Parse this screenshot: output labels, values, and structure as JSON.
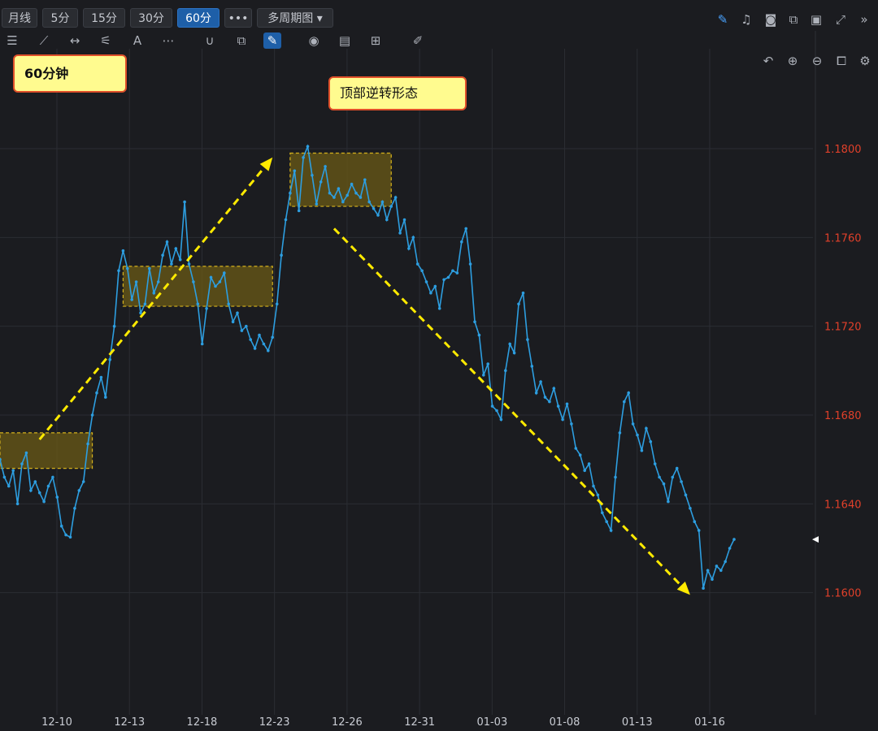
{
  "toolbar": {
    "periods": [
      "月线",
      "5分",
      "15分",
      "30分",
      "60分"
    ],
    "active_period": "60分",
    "more_label": "•••",
    "multi_period_label": "多周期图",
    "multi_period_caret": "▾",
    "drawing_tools": [
      "drawing-mode-icon",
      "ray-icon",
      "fib-fan-icon",
      "range-icon",
      "pitchfork-icon",
      "text-icon",
      "more-tools-icon",
      "magnet-icon",
      "layers-icon",
      "pen-icon",
      "eye-icon",
      "trash-icon",
      "grid-icon",
      "ruler-icon"
    ],
    "right_icons": [
      "edit-icon",
      "bell-icon",
      "camera-icon",
      "window-icon",
      "monitor-icon",
      "fullscreen-icon",
      "expand-right-icon"
    ],
    "chart_controls": [
      "undo-icon",
      "zoom-in-icon",
      "zoom-out-icon",
      "crop-icon",
      "settings-icon"
    ]
  },
  "annotations": {
    "label_60min": "60分钟",
    "label_reversal": "顶部逆转形态"
  },
  "colors": {
    "background": "#1b1c20",
    "grid": "#2b2d33",
    "price_line": "#2d9ee0",
    "axis_text": "#e0402a",
    "date_text": "#c9ccd3",
    "arrow": "#ffea00",
    "box_fill": "#6b5a16",
    "box_border": "#d6b21c"
  },
  "chart_data": {
    "type": "line",
    "title": "",
    "xlabel": "",
    "ylabel": "",
    "ylim": [
      1.1545,
      1.1845
    ],
    "y_ticks": [
      "1.1600",
      "1.1640",
      "1.1680",
      "1.1720",
      "1.1760",
      "1.1800"
    ],
    "x_ticks": [
      "12-10",
      "12-13",
      "12-18",
      "12-23",
      "12-26",
      "12-31",
      "01-03",
      "01-08",
      "01-13",
      "01-16"
    ],
    "current_price_marker": "1.1624",
    "series": [
      {
        "values": [
          1.166,
          1.1652,
          1.1648,
          1.1655,
          1.164,
          1.1658,
          1.1663,
          1.1646,
          1.165,
          1.1645,
          1.1641,
          1.1648,
          1.1652,
          1.1643,
          1.163,
          1.1626,
          1.1625,
          1.1638,
          1.1646,
          1.165,
          1.1667,
          1.168,
          1.169,
          1.1697,
          1.1688,
          1.1705,
          1.172,
          1.1745,
          1.1754,
          1.1746,
          1.1732,
          1.174,
          1.1726,
          1.173,
          1.1746,
          1.1735,
          1.174,
          1.1752,
          1.1758,
          1.1748,
          1.1755,
          1.175,
          1.1776,
          1.1748,
          1.174,
          1.173,
          1.1712,
          1.1728,
          1.1742,
          1.1738,
          1.174,
          1.1744,
          1.173,
          1.1722,
          1.1726,
          1.1718,
          1.172,
          1.1714,
          1.171,
          1.1716,
          1.1712,
          1.1709,
          1.1715,
          1.173,
          1.1752,
          1.1768,
          1.178,
          1.179,
          1.1772,
          1.1796,
          1.1801,
          1.1788,
          1.1775,
          1.1785,
          1.1792,
          1.178,
          1.1778,
          1.1782,
          1.1776,
          1.1779,
          1.1784,
          1.178,
          1.1778,
          1.1786,
          1.1776,
          1.1773,
          1.177,
          1.1776,
          1.1768,
          1.1774,
          1.1778,
          1.1762,
          1.1768,
          1.1755,
          1.176,
          1.1748,
          1.1745,
          1.174,
          1.1735,
          1.1738,
          1.1728,
          1.1741,
          1.1742,
          1.1745,
          1.1744,
          1.1758,
          1.1764,
          1.1748,
          1.1722,
          1.1716,
          1.1698,
          1.1703,
          1.1684,
          1.1682,
          1.1678,
          1.17,
          1.1712,
          1.1708,
          1.173,
          1.1735,
          1.1714,
          1.1702,
          1.169,
          1.1695,
          1.1688,
          1.1686,
          1.1692,
          1.1684,
          1.1678,
          1.1685,
          1.1676,
          1.1665,
          1.1662,
          1.1655,
          1.1658,
          1.1648,
          1.1644,
          1.1636,
          1.1632,
          1.1628,
          1.1652,
          1.1672,
          1.1686,
          1.169,
          1.1676,
          1.1671,
          1.1664,
          1.1674,
          1.1668,
          1.1658,
          1.1652,
          1.1649,
          1.1641,
          1.1652,
          1.1656,
          1.165,
          1.1644,
          1.1638,
          1.1632,
          1.1628,
          1.1602,
          1.161,
          1.1606,
          1.1612,
          1.161,
          1.1614,
          1.162,
          1.1624
        ]
      }
    ],
    "consolidation_zones": [
      {
        "x_start": 0,
        "x_end": 21,
        "y_low": 1.1656,
        "y_high": 1.1672
      },
      {
        "x_start": 28,
        "x_end": 62,
        "y_low": 1.1729,
        "y_high": 1.1747
      },
      {
        "x_start": 66,
        "x_end": 89,
        "y_low": 1.1774,
        "y_high": 1.1798
      }
    ],
    "trend_arrows": [
      {
        "from": [
          9,
          1.1669
        ],
        "to": [
          62,
          1.1796
        ],
        "direction": "up"
      },
      {
        "from": [
          76,
          1.1764
        ],
        "to": [
          157,
          1.1599
        ],
        "direction": "down"
      }
    ]
  }
}
